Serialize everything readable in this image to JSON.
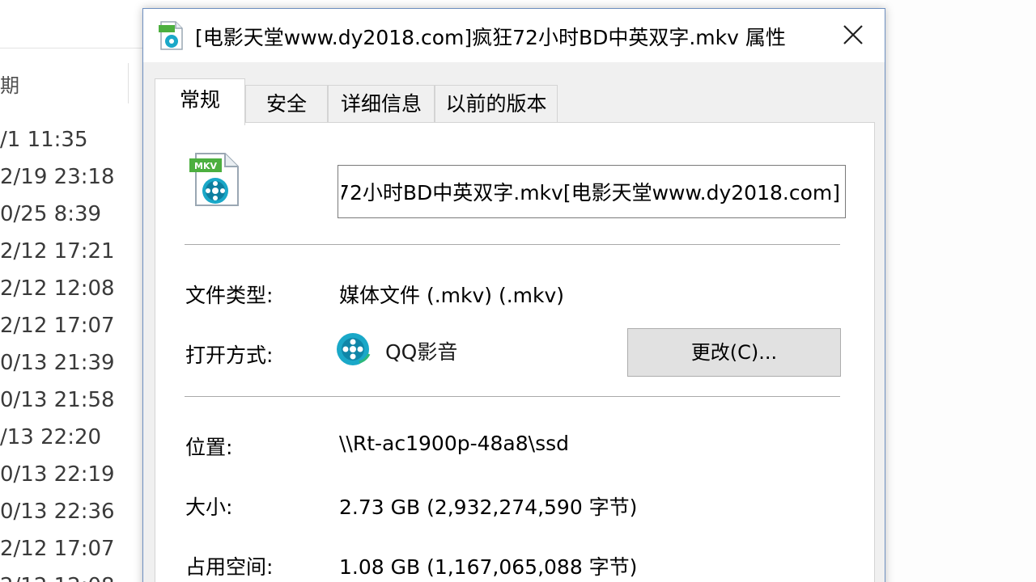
{
  "explorer": {
    "column_header": "期",
    "dates": [
      "/1 11:35",
      "2/19 23:18",
      "0/25 8:39",
      "2/12 17:21",
      "2/12 12:08",
      "2/12 17:07",
      "0/13 21:39",
      "0/13 21:58",
      "/13 22:20",
      "0/13 22:19",
      "0/13 22:36",
      "2/12 17:07",
      "2/12 12:08"
    ]
  },
  "dialog": {
    "title": "[电影天堂www.dy2018.com]疯狂72小时BD中英双字.mkv 属性",
    "close_icon": "close-icon",
    "tabs": [
      {
        "label": "常规",
        "active": true
      },
      {
        "label": "安全",
        "active": false
      },
      {
        "label": "详细信息",
        "active": false
      },
      {
        "label": "以前的版本",
        "active": false
      }
    ],
    "file_icon_badge": "MKV",
    "file_name_value": "[电影天堂www.dy2018.com]疯狂72小时BD中英双字.mkv",
    "file_name_visible": "天堂www.dy2018.com]疯狂72小时BD中英双字.mkv",
    "file_type": {
      "label": "文件类型:",
      "value": "媒体文件 (.mkv) (.mkv)"
    },
    "open_with": {
      "label": "打开方式:",
      "app_name": "QQ影音",
      "app_icon": "qq-player-icon",
      "change_label": "更改(C)..."
    },
    "location": {
      "label": "位置:",
      "value": "\\\\Rt-ac1900p-48a8\\ssd"
    },
    "size": {
      "label": "大小:",
      "value": "2.73 GB (2,932,274,590 字节)"
    },
    "size_on_disk": {
      "label": "占用空间:",
      "value": "1.08 GB (1,167,065,088 字节)"
    }
  },
  "colors": {
    "dialog_border": "#6d8fc0",
    "dialog_bg": "#f0f0f0",
    "button_bg": "#e1e1e1",
    "icon_teal": "#1aa8c8",
    "icon_green": "#4caf3f"
  }
}
